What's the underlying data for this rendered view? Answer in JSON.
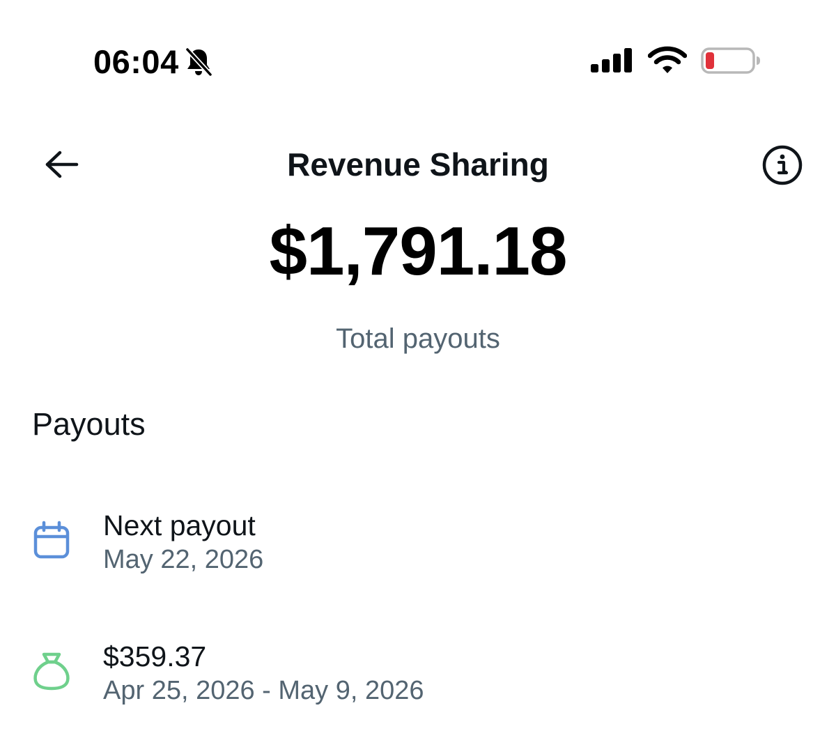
{
  "status_bar": {
    "time": "06:04",
    "icons": [
      "bell-slash-icon",
      "cellular-signal-icon",
      "wifi-icon",
      "battery-icon"
    ],
    "battery_color": "#e0313a"
  },
  "header": {
    "title": "Revenue Sharing",
    "back_icon": "arrow-left-icon",
    "info_icon": "info-circle-icon"
  },
  "summary": {
    "total_amount": "$1,791.18",
    "total_label": "Total payouts"
  },
  "payouts": {
    "heading": "Payouts",
    "items": [
      {
        "icon": "calendar-icon",
        "icon_color": "#5b8fd9",
        "title": "Next payout",
        "subtitle": "May 22, 2026"
      },
      {
        "icon": "money-bag-icon",
        "icon_color": "#6fd08c",
        "title": "$359.37",
        "subtitle": "Apr 25, 2026 - May 9, 2026"
      }
    ]
  },
  "colors": {
    "text_primary": "#0f1419",
    "text_secondary": "#536471",
    "background": "#ffffff"
  }
}
